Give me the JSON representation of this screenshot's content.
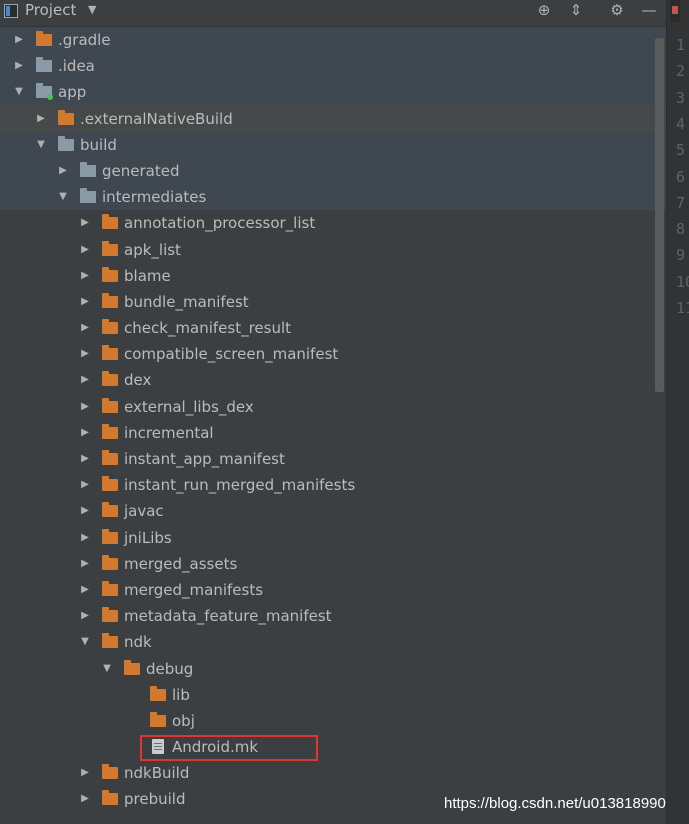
{
  "panel": {
    "title": "Project",
    "icons": [
      "locate-icon",
      "collapse-all-icon",
      "gear-icon",
      "hide-icon"
    ]
  },
  "tree": [
    {
      "label": ".gradle",
      "depth": 0,
      "expanded": false,
      "icon": "folder-orange",
      "highlight": "blue"
    },
    {
      "label": ".idea",
      "depth": 0,
      "expanded": false,
      "icon": "folder-gray",
      "highlight": "blue"
    },
    {
      "label": "app",
      "depth": 0,
      "expanded": true,
      "icon": "module-folder",
      "highlight": "blue"
    },
    {
      "label": ".externalNativeBuild",
      "depth": 1,
      "expanded": false,
      "icon": "folder-orange",
      "highlight": "gray"
    },
    {
      "label": "build",
      "depth": 1,
      "expanded": true,
      "icon": "folder-gray",
      "highlight": "blue"
    },
    {
      "label": "generated",
      "depth": 2,
      "expanded": false,
      "icon": "folder-gray",
      "highlight": "blue"
    },
    {
      "label": "intermediates",
      "depth": 2,
      "expanded": true,
      "icon": "folder-gray",
      "highlight": "blue"
    },
    {
      "label": "annotation_processor_list",
      "depth": 3,
      "expanded": false,
      "icon": "folder-orange"
    },
    {
      "label": "apk_list",
      "depth": 3,
      "expanded": false,
      "icon": "folder-orange"
    },
    {
      "label": "blame",
      "depth": 3,
      "expanded": false,
      "icon": "folder-orange"
    },
    {
      "label": "bundle_manifest",
      "depth": 3,
      "expanded": false,
      "icon": "folder-orange"
    },
    {
      "label": "check_manifest_result",
      "depth": 3,
      "expanded": false,
      "icon": "folder-orange"
    },
    {
      "label": "compatible_screen_manifest",
      "depth": 3,
      "expanded": false,
      "icon": "folder-orange"
    },
    {
      "label": "dex",
      "depth": 3,
      "expanded": false,
      "icon": "folder-orange"
    },
    {
      "label": "external_libs_dex",
      "depth": 3,
      "expanded": false,
      "icon": "folder-orange"
    },
    {
      "label": "incremental",
      "depth": 3,
      "expanded": false,
      "icon": "folder-orange"
    },
    {
      "label": "instant_app_manifest",
      "depth": 3,
      "expanded": false,
      "icon": "folder-orange"
    },
    {
      "label": "instant_run_merged_manifests",
      "depth": 3,
      "expanded": false,
      "icon": "folder-orange"
    },
    {
      "label": "javac",
      "depth": 3,
      "expanded": false,
      "icon": "folder-orange"
    },
    {
      "label": "jniLibs",
      "depth": 3,
      "expanded": false,
      "icon": "folder-orange"
    },
    {
      "label": "merged_assets",
      "depth": 3,
      "expanded": false,
      "icon": "folder-orange"
    },
    {
      "label": "merged_manifests",
      "depth": 3,
      "expanded": false,
      "icon": "folder-orange"
    },
    {
      "label": "metadata_feature_manifest",
      "depth": 3,
      "expanded": false,
      "icon": "folder-orange"
    },
    {
      "label": "ndk",
      "depth": 3,
      "expanded": true,
      "icon": "folder-orange"
    },
    {
      "label": "debug",
      "depth": 4,
      "expanded": true,
      "icon": "folder-orange"
    },
    {
      "label": "lib",
      "depth": 5,
      "icon": "folder-orange"
    },
    {
      "label": "obj",
      "depth": 5,
      "icon": "folder-orange"
    },
    {
      "label": "Android.mk",
      "depth": 5,
      "icon": "file",
      "selected": true
    },
    {
      "label": "ndkBuild",
      "depth": 3,
      "expanded": false,
      "icon": "folder-orange"
    },
    {
      "label": "prebuild",
      "depth": 3,
      "expanded": false,
      "icon": "folder-orange"
    }
  ],
  "gutter_lines": [
    "1",
    "2",
    "3",
    "4",
    "5",
    "6",
    "7",
    "8",
    "9",
    "10",
    "11"
  ],
  "watermark": "https://blog.csdn.net/u013818990",
  "colors": {
    "background": "#3c3f41",
    "folder_orange": "#d17a2f",
    "folder_gray": "#8a9aa6",
    "selection_box": "#e03434"
  }
}
